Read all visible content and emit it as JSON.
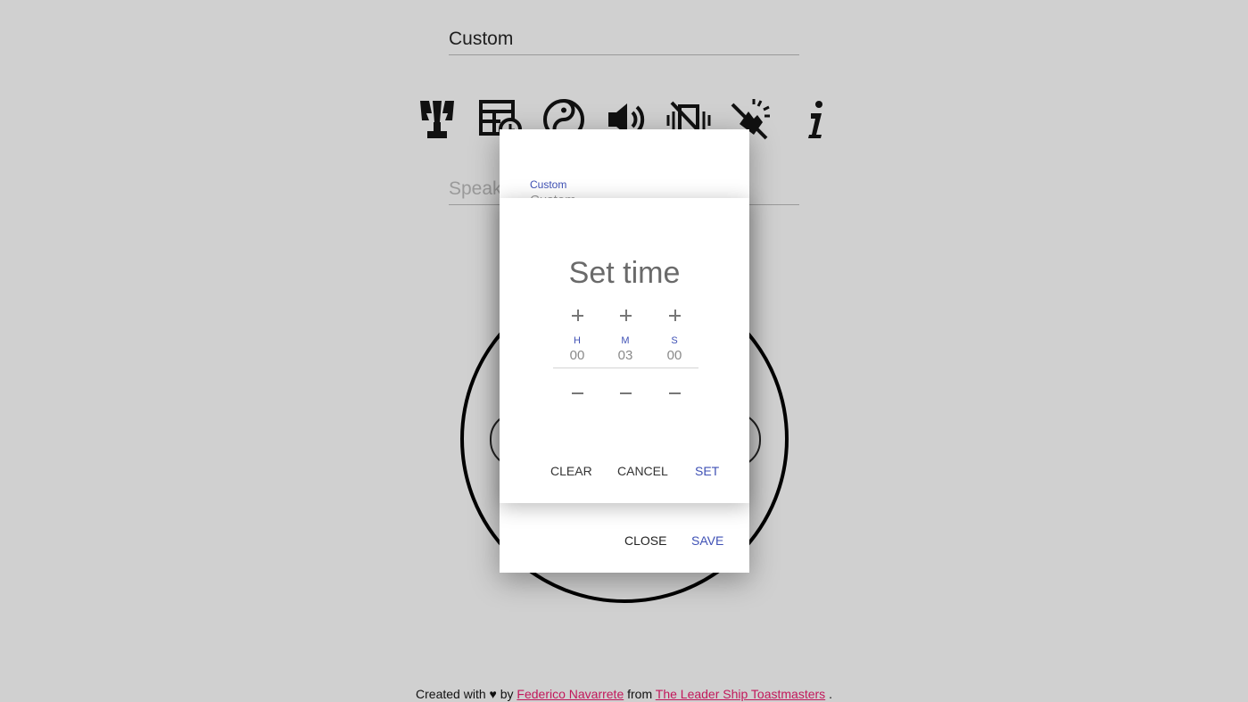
{
  "page": {
    "title_field_value": "Custom",
    "speaker_placeholder": "Speaker name"
  },
  "toolbar": {
    "icons": [
      {
        "name": "trophy-icon"
      },
      {
        "name": "schedule-table-icon"
      },
      {
        "name": "yin-yang-icon"
      },
      {
        "name": "volume-icon"
      },
      {
        "name": "vibration-off-icon"
      },
      {
        "name": "flash-off-icon"
      },
      {
        "name": "info-icon"
      }
    ]
  },
  "modal": {
    "field_label": "Custom",
    "field_value": "Custom",
    "close_label": "CLOSE",
    "save_label": "SAVE",
    "accent_color": "#3f51b5"
  },
  "time_picker": {
    "title": "Set time",
    "hours_label": "H",
    "minutes_label": "M",
    "seconds_label": "S",
    "hours": "00",
    "minutes": "03",
    "seconds": "00",
    "clear_label": "CLEAR",
    "cancel_label": "CANCEL",
    "set_label": "SET"
  },
  "footer": {
    "prefix": "Created with ♥ by",
    "author": "Federico Navarrete",
    "middle": "from",
    "club": "The Leader Ship Toastmasters",
    "suffix": "."
  }
}
